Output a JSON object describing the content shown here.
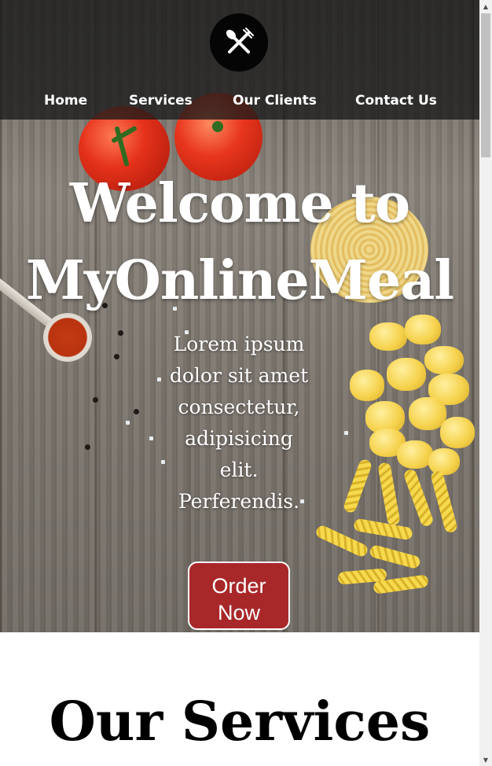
{
  "navbar": {
    "logo_icon": "fork-spoon-icon",
    "links": [
      {
        "label": "Home"
      },
      {
        "label": "Services"
      },
      {
        "label": "Our Clients"
      },
      {
        "label": "Contact Us"
      }
    ]
  },
  "hero": {
    "title": "Welcome to MyOnlineMeal",
    "text": "Lorem ipsum dolor sit amet consectetur, adipisicing elit. Perferendis.",
    "order_button": "Order Now"
  },
  "services": {
    "title": "Our Services"
  },
  "colors": {
    "nav_background": "#191919",
    "button_red": "#a8282a",
    "text_white": "#ffffff"
  },
  "scrollbar": {
    "up_icon": "scroll-up-arrow-icon",
    "down_icon": "scroll-down-arrow-icon"
  }
}
